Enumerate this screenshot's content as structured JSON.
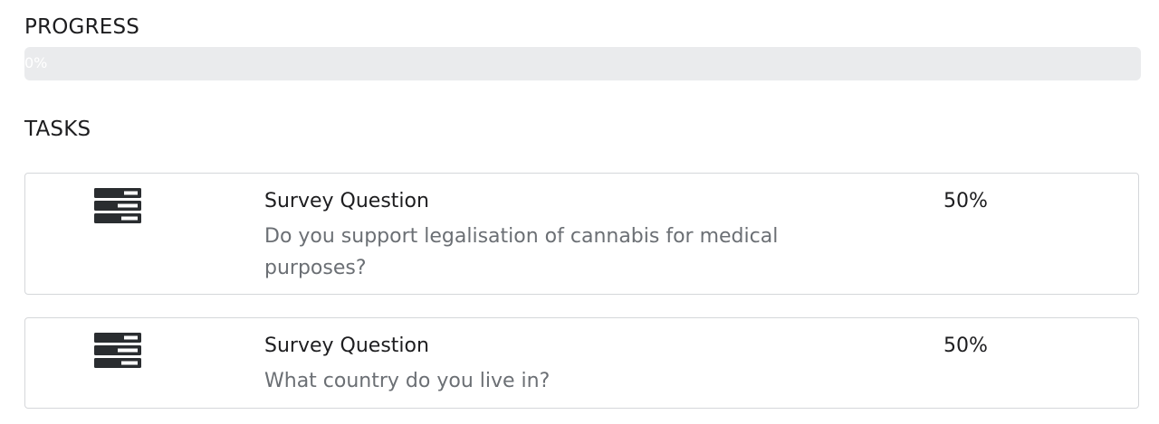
{
  "progress": {
    "heading": "PROGRESS",
    "value_text": "0%",
    "value": 0,
    "track_color": "#eaebed",
    "fill_color": "#4a90d9"
  },
  "tasks": {
    "heading": "TASKS",
    "items": [
      {
        "icon": "server-stack-icon",
        "title": "Survey Question",
        "question": "Do you support legalisation of cannabis for medical purposes?",
        "percent": "50%"
      },
      {
        "icon": "server-stack-icon",
        "title": "Survey Question",
        "question": "What country do you live in?",
        "percent": "50%"
      }
    ]
  }
}
